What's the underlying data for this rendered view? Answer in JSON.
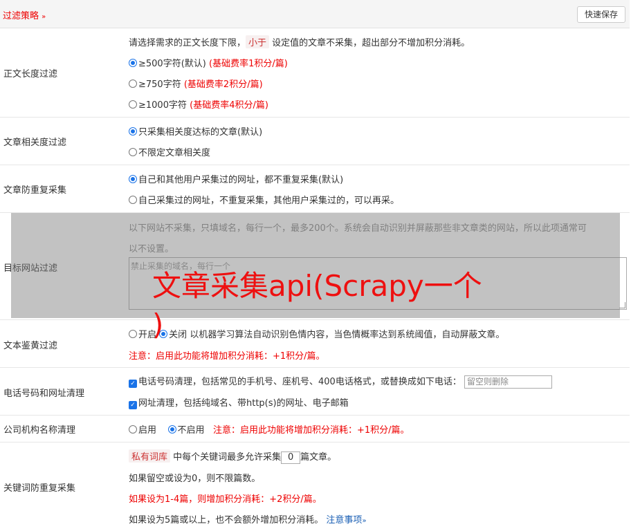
{
  "header": {
    "title": "过滤策略",
    "title_icon": "double-chevron-down",
    "save_label": "快速保存"
  },
  "length_filter": {
    "label": "正文长度过滤",
    "desc_pre": "请选择需求的正文长度下限，",
    "desc_tag": "小于",
    "desc_post": "设定值的文章不采集，超出部分不增加积分消耗。",
    "options": [
      {
        "text": "≥500字符(默认)",
        "note": "(基础费率1积分/篇)",
        "selected": true
      },
      {
        "text": "≥750字符",
        "note": "(基础费率2积分/篇)",
        "selected": false
      },
      {
        "text": "≥1000字符",
        "note": "(基础费率4积分/篇)",
        "selected": false
      }
    ]
  },
  "relevance": {
    "label": "文章相关度过滤",
    "options": [
      {
        "text": "只采集相关度达标的文章(默认)",
        "selected": true
      },
      {
        "text": "不限定文章相关度",
        "selected": false
      }
    ]
  },
  "dedupe": {
    "label": "文章防重复采集",
    "options": [
      {
        "text": "自己和其他用户采集过的网址，都不重复采集(默认)",
        "selected": true
      },
      {
        "text": "自己采集过的网址，不重复采集，其他用户采集过的，可以再采。",
        "selected": false
      }
    ]
  },
  "site_filter": {
    "label": "目标网站过滤",
    "desc_line1": "以下网站不采集，只填域名，每行一个，最多200个。系统会自动识别并屏蔽那些非文章类的网站，所以此项通常可",
    "desc_line2": "以不设置。",
    "placeholder": "禁止采集的域名，每行一个"
  },
  "watermark": {
    "line1": "文章采集api(Scrapy一个",
    "line2": ")"
  },
  "porn_filter": {
    "label": "文本鉴黄过滤",
    "on_label": "开启",
    "off_label": "关闭",
    "off_selected": true,
    "desc": "以机器学习算法自动识别色情内容，当色情概率达到系统阈值，自动屏蔽文章。",
    "note": "注意：启用此功能将增加积分消耗：+1积分/篇。"
  },
  "phone_clean": {
    "label": "电话号码和网址清理",
    "phone_text": "电话号码清理，包括常见的手机号、座机号、400电话格式，或替换成如下电话：",
    "phone_placeholder": "留空则删除",
    "url_text": "网址清理，包括纯域名、带http(s)的网址、电子邮箱",
    "phone_checked": true,
    "url_checked": true
  },
  "org_clean": {
    "label": "公司机构名称清理",
    "on_label": "启用",
    "off_label": "不启用",
    "off_selected": true,
    "note": "注意：启用此功能将增加积分消耗：+1积分/篇。"
  },
  "keyword_dedupe": {
    "label": "关键词防重复采集",
    "tag": "私有词库",
    "pre": "中每个关键词最多允许采集",
    "value": "0",
    "post": "篇文章。",
    "line2": "如果留空或设为0，则不限篇数。",
    "line3": "如果设为1-4篇，则增加积分消耗：+2积分/篇。",
    "line4": "如果设为5篇或以上，也不会额外增加积分消耗。",
    "link": "注意事项",
    "link_icon": "double-chevron-down"
  }
}
